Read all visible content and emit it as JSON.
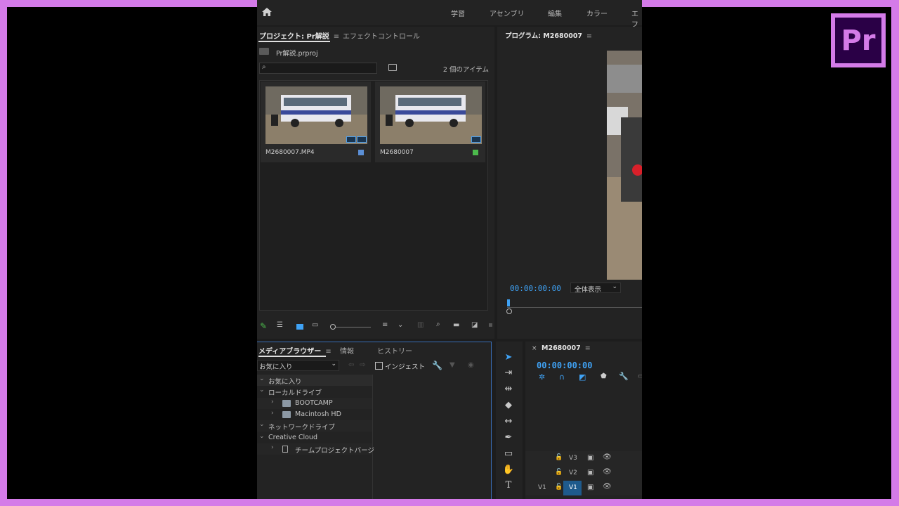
{
  "workspaces": [
    "学習",
    "アセンブリ",
    "編集",
    "カラー",
    "エフ"
  ],
  "project_panel": {
    "tab_project": "プロジェクト: Pr解説",
    "tab_effect_controls": "エフェクトコントロール",
    "project_file": "Pr解説.prproj",
    "search_placeholder": "",
    "item_count": "2 個のアイテム",
    "items": [
      {
        "name": "M2680007.MP4",
        "color": "#5b8fd6"
      },
      {
        "name": "M2680007",
        "color": "#4cba4c"
      }
    ]
  },
  "program_monitor": {
    "title": "プログラム: M2680007",
    "timecode": "00:00:00:00",
    "zoom": "全体表示"
  },
  "media_browser": {
    "tab_media_browser": "メディアブラウザー",
    "tab_info": "情報",
    "tab_history": "ヒストリー",
    "favorites_select": "お気に入り",
    "ingest_label": "インジェスト",
    "tree": [
      {
        "label": "お気に入り"
      },
      {
        "label": "ローカルドライブ"
      },
      {
        "label": "BOOTCAMP"
      },
      {
        "label": "Macintosh HD"
      },
      {
        "label": "ネットワークドライブ"
      },
      {
        "label": "Creative Cloud"
      },
      {
        "label": "チームプロジェクトバージ"
      }
    ]
  },
  "timeline": {
    "sequence_name": "M2680007",
    "timecode": "00:00:00:00",
    "tracks": [
      {
        "name": "V3",
        "source": ""
      },
      {
        "name": "V2",
        "source": ""
      },
      {
        "name": "V1",
        "source": "V1"
      }
    ]
  },
  "brand_logo_text": "Pr",
  "colors": {
    "accent_blue": "#3fa2f5",
    "brand_purple": "#d47be8"
  }
}
